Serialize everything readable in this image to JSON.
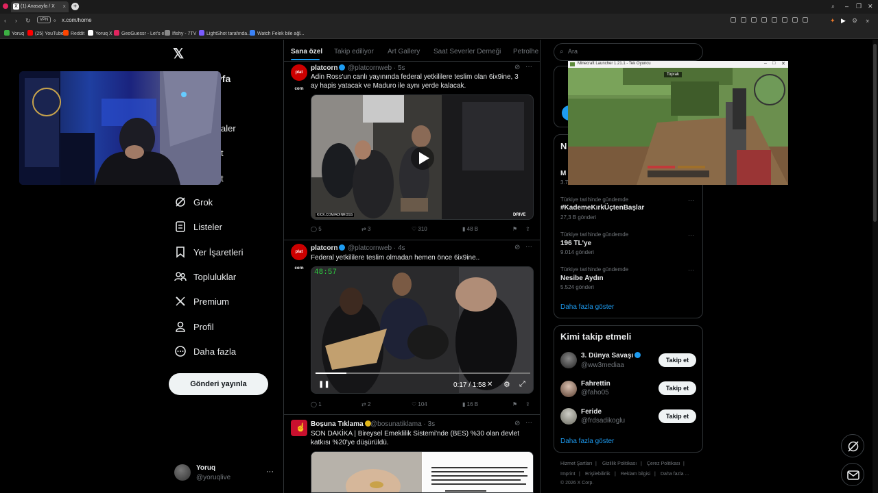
{
  "browser": {
    "tab_title": "(1) Anasayfa / X",
    "url": "x.com/home",
    "vpn_label": "VPN",
    "bookmarks": [
      {
        "label": "Yoruq",
        "color": "#3cb043"
      },
      {
        "label": "(25) YouTube",
        "color": "#ff0000"
      },
      {
        "label": "Reddit",
        "color": "#ff4500"
      },
      {
        "label": "Yoruq X",
        "color": "#ffffff"
      },
      {
        "label": "GeoGuessr - Let's e...",
        "color": "#e0245e"
      },
      {
        "label": "Ifishy - 7TV",
        "color": "#888888"
      },
      {
        "label": "LightShot tarafında...",
        "color": "#7a5cff"
      },
      {
        "label": "Watch Felek bile ağl...",
        "color": "#3b82f6"
      }
    ]
  },
  "nav": {
    "home_partial": "yfa",
    "partial_items": [
      "aler",
      "t",
      "t"
    ],
    "items": [
      {
        "label": "Grok",
        "icon": "grok-icon"
      },
      {
        "label": "Listeler",
        "icon": "list-icon"
      },
      {
        "label": "Yer İşaretleri",
        "icon": "bookmark-icon"
      },
      {
        "label": "Topluluklar",
        "icon": "communities-icon"
      },
      {
        "label": "Premium",
        "icon": "x-premium-icon"
      },
      {
        "label": "Profil",
        "icon": "profile-icon"
      },
      {
        "label": "Daha fazla",
        "icon": "more-circle-icon"
      }
    ],
    "post_button": "Gönderi yayınla",
    "account": {
      "name": "Yoruq",
      "handle": "@yoruqlive",
      "more": "···"
    }
  },
  "feed": {
    "tabs": [
      "Sana özel",
      "Takip ediliyor",
      "Art Gallery",
      "Saat Severler Derneği",
      "Petrolhe"
    ],
    "posts": [
      {
        "name": "platcorn",
        "handle": "@platcornweb · 5s",
        "text": "Adin Ross'un canlı yayınında federal yetkililere teslim olan 6ix9ine, 3 ay hapis yatacak ve Maduro ile aynı yerde kalacak.",
        "avatar_label": "plat corn",
        "media_watermark": "KICK.COM/ADINROSS",
        "media_badge": "DRIVE",
        "stats": {
          "replies": "5",
          "reposts": "3",
          "likes": "310",
          "views": "48 B"
        }
      },
      {
        "name": "platcorn",
        "handle": "@platcornweb · 4s",
        "text": "Federal yetkililere teslim olmadan hemen önce 6ix9ine..",
        "avatar_label": "plat corn",
        "media_timer": "48:57",
        "media_time": "0:17 / 1:58",
        "stats": {
          "replies": "1",
          "reposts": "2",
          "likes": "104",
          "views": "16 B"
        }
      },
      {
        "name": "Boşuna Tıklama",
        "handle": "@bosunatiklama · 3s",
        "text": "SON DAKİKA | Bireysel Emeklilik Sistemi'nde (BES) %30 olan devlet katkısı %20'ye düşürüldü."
      }
    ]
  },
  "right": {
    "search_placeholder": "Ara",
    "trends_heading_partial": "N",
    "trend_partial": "M",
    "trend_partial_count": "3.7",
    "trends": [
      {
        "context": "Türkiye tarihinde gündemde",
        "title": "#KademeKırkÜçtenBaşlar",
        "count": "27,3 B gönderi"
      },
      {
        "context": "Türkiye tarihinde gündemde",
        "title": "196 TL'ye",
        "count": "9.014 gönderi"
      },
      {
        "context": "Türkiye tarihinde gündemde",
        "title": "Nesibe Aydın",
        "count": "5.524 gönderi"
      }
    ],
    "trends_show_more": "Daha fazla göster",
    "who_to_follow": {
      "title": "Kimi takip etmeli",
      "users": [
        {
          "name": "3. Dünya Savaşı",
          "handle": "@ww3mediaa",
          "verified": true
        },
        {
          "name": "Fahrettin",
          "handle": "@faho05",
          "verified": false
        },
        {
          "name": "Feride",
          "handle": "@frdsadikoglu",
          "verified": false
        }
      ],
      "follow_label": "Takip et",
      "show_more": "Daha fazla göster"
    },
    "footer": [
      "Hizmet Şartları",
      "|",
      "Gizlilik Politikası",
      "|",
      "Çerez Politikası",
      "|",
      "Imprint",
      "|",
      "Erişilebilirlik",
      "|",
      "Reklam bilgisi",
      "|",
      "Daha fazla ...",
      "© 2026 X Corp."
    ]
  },
  "minecraft": {
    "window_title": "Minecraft Launcher 1.21.1 - Tek Oyuncu",
    "tooltip": "Toprak"
  }
}
